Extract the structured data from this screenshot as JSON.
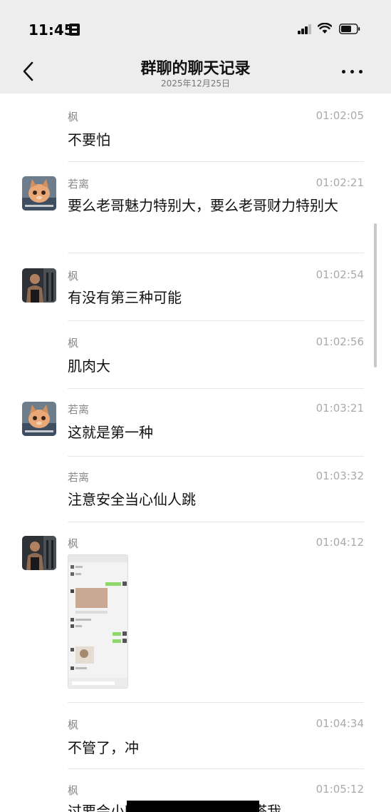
{
  "status_bar": {
    "time": "11:45"
  },
  "header": {
    "title": "群聊的聊天记录",
    "subtitle": "2025年12月25日"
  },
  "messages": [
    {
      "sender": "枫",
      "time": "01:02:05",
      "text": "不要怕",
      "avatar": ""
    },
    {
      "sender": "若离",
      "time": "01:02:21",
      "text": "要么老哥魅力特别大，要么老哥财力特别大",
      "avatar": "cat-avatar"
    },
    {
      "sender": "枫",
      "time": "01:02:54",
      "text": "有没有第三种可能",
      "avatar": "gym-avatar"
    },
    {
      "sender": "枫",
      "time": "01:02:56",
      "text": "肌肉大",
      "avatar": ""
    },
    {
      "sender": "若离",
      "time": "01:03:21",
      "text": "这就是第一种",
      "avatar": "cat-avatar"
    },
    {
      "sender": "若离",
      "time": "01:03:32",
      "text": "注意安全当心仙人跳",
      "avatar": ""
    },
    {
      "sender": "枫",
      "time": "01:04:12",
      "text": "",
      "avatar": "gym-avatar",
      "image": "chat-screenshot-thumbnail"
    },
    {
      "sender": "枫",
      "time": "01:04:34",
      "text": "不管了，冲",
      "avatar": ""
    },
    {
      "sender": "枫",
      "time": "01:05:12",
      "text": "过要会小时没动静，群里记得搭我",
      "avatar": ""
    }
  ],
  "colors": {
    "header_bg": "#ededed",
    "divider": "#e6e6e6",
    "sender": "#8a8a8a",
    "timestamp": "#aaaaaa"
  }
}
